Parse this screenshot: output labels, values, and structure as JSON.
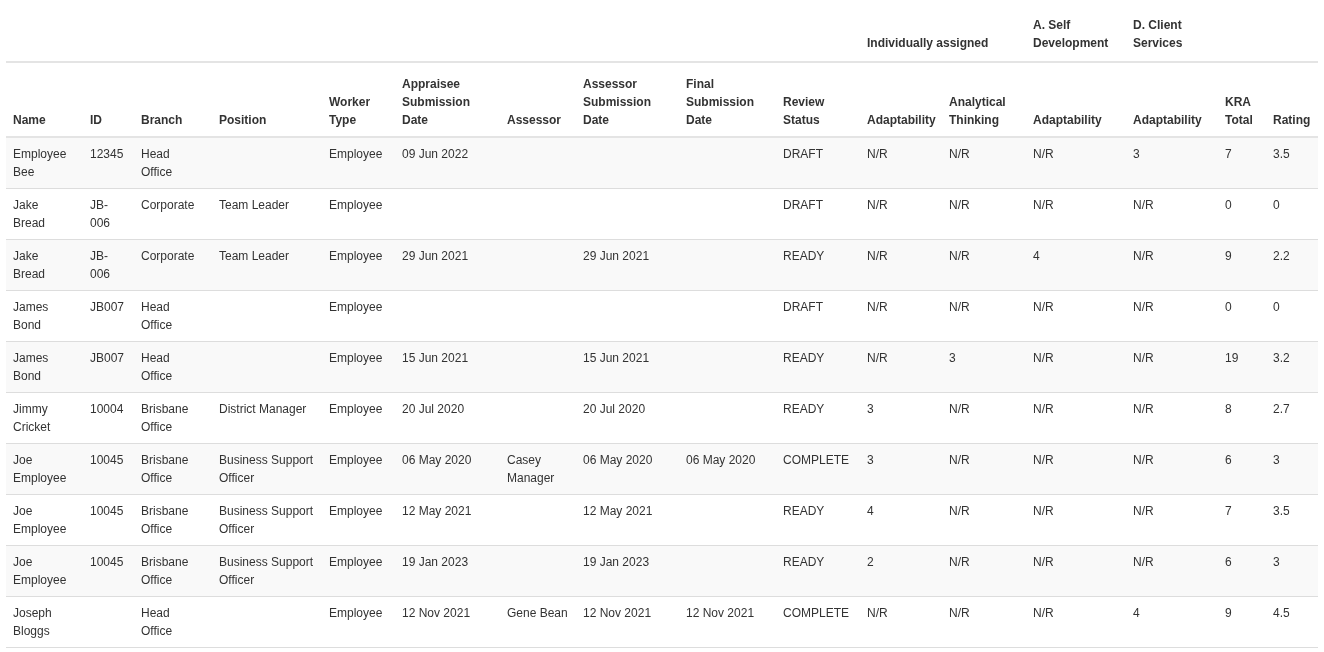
{
  "table": {
    "column_groups": [
      {
        "colspan": 10
      },
      {
        "label": "Individually assigned",
        "colspan": 2
      },
      {
        "label": "A. Self Development"
      },
      {
        "label": "D. Client Services"
      },
      {
        "colspan": 2
      }
    ],
    "columns": [
      {
        "label": "Name"
      },
      {
        "label": "ID"
      },
      {
        "label": "Branch"
      },
      {
        "label": "Position"
      },
      {
        "label": "Worker Type"
      },
      {
        "label": "Appraisee Submission Date"
      },
      {
        "label": "Assessor"
      },
      {
        "label": "Assessor Submission Date"
      },
      {
        "label": "Final Submission Date"
      },
      {
        "label": "Review Status"
      },
      {
        "label": "Adaptability"
      },
      {
        "label": "Analytical Thinking"
      },
      {
        "label": "Adaptability"
      },
      {
        "label": "Adaptability"
      },
      {
        "label": "KRA Total"
      },
      {
        "label": "Rating"
      }
    ],
    "rows": [
      [
        "Employee Bee",
        "12345",
        "Head Office",
        null,
        "Employee",
        "09 Jun 2022",
        null,
        null,
        null,
        "DRAFT",
        "N/R",
        "N/R",
        "N/R",
        "3",
        "7",
        "3.5"
      ],
      [
        "Jake Bread",
        "JB-006",
        "Corporate",
        "Team Leader",
        "Employee",
        null,
        null,
        null,
        null,
        "DRAFT",
        "N/R",
        "N/R",
        "N/R",
        "N/R",
        "0",
        "0"
      ],
      [
        "Jake Bread",
        "JB-006",
        "Corporate",
        "Team Leader",
        "Employee",
        "29 Jun 2021",
        null,
        "29 Jun 2021",
        null,
        "READY",
        "N/R",
        "N/R",
        "4",
        "N/R",
        "9",
        "2.2"
      ],
      [
        "James Bond",
        "JB007",
        "Head Office",
        null,
        "Employee",
        null,
        null,
        null,
        null,
        "DRAFT",
        "N/R",
        "N/R",
        "N/R",
        "N/R",
        "0",
        "0"
      ],
      [
        "James Bond",
        "JB007",
        "Head Office",
        null,
        "Employee",
        "15 Jun 2021",
        null,
        "15 Jun 2021",
        null,
        "READY",
        "N/R",
        "3",
        "N/R",
        "N/R",
        "19",
        "3.2"
      ],
      [
        "Jimmy Cricket",
        "10004",
        "Brisbane Office",
        "District Manager",
        "Employee",
        "20 Jul 2020",
        null,
        "20 Jul 2020",
        null,
        "READY",
        "3",
        "N/R",
        "N/R",
        "N/R",
        "8",
        "2.7"
      ],
      [
        "Joe Employee",
        "10045",
        "Brisbane Office",
        "Business Support Officer",
        "Employee",
        "06 May 2020",
        "Casey Manager",
        "06 May 2020",
        "06 May 2020",
        "COMPLETE",
        "3",
        "N/R",
        "N/R",
        "N/R",
        "6",
        "3"
      ],
      [
        "Joe Employee",
        "10045",
        "Brisbane Office",
        "Business Support Officer",
        "Employee",
        "12 May 2021",
        null,
        "12 May 2021",
        null,
        "READY",
        "4",
        "N/R",
        "N/R",
        "N/R",
        "7",
        "3.5"
      ],
      [
        "Joe Employee",
        "10045",
        "Brisbane Office",
        "Business Support Officer",
        "Employee",
        "19 Jan 2023",
        null,
        "19 Jan 2023",
        null,
        "READY",
        "2",
        "N/R",
        "N/R",
        "N/R",
        "6",
        "3"
      ],
      [
        "Joseph Bloggs",
        null,
        "Head Office",
        null,
        "Employee",
        "12 Nov 2021",
        "Gene Bean",
        "12 Nov 2021",
        "12 Nov 2021",
        "COMPLETE",
        "N/R",
        "N/R",
        "N/R",
        "4",
        "9",
        "4.5"
      ]
    ]
  }
}
